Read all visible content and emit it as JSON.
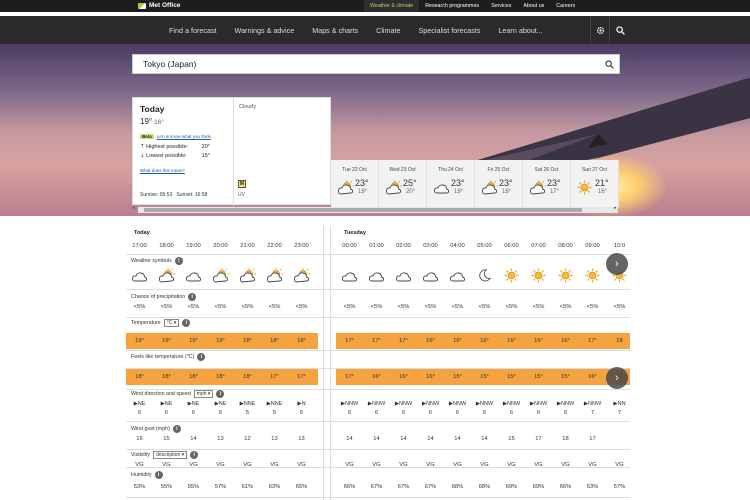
{
  "header": {
    "logo": "Met Office",
    "util_links": [
      "Weather & climate",
      "Research programmes",
      "Services",
      "About us",
      "Careers"
    ]
  },
  "nav": {
    "links": [
      "Find a forecast",
      "Warnings & advice",
      "Maps & charts",
      "Climate",
      "Specialist forecasts",
      "Learn about..."
    ]
  },
  "search": {
    "value": "Tokyo (Japan)"
  },
  "today_card": {
    "title": "Today",
    "high": "19°",
    "low": "16°",
    "beta": "Beta",
    "beta_link": "Let us know what you think",
    "highest_label": "Highest possible:",
    "highest": "20°",
    "lowest_label": "Lowest possible:",
    "lowest": "15°",
    "meaning_link": "What does this mean?",
    "sunrise_label": "Sunrise:",
    "sunrise": "05:53",
    "sunset_label": "Sunset:",
    "sunset": "16:58",
    "condition": "Cloudy",
    "uv_value": "M",
    "uv_label": "UV"
  },
  "days": [
    {
      "label": "Tue 22 Oct",
      "high": "23°",
      "low": "19°",
      "icon": "sunny-interval-icon"
    },
    {
      "label": "Wed 23 Oct",
      "high": "25°",
      "low": "20°",
      "icon": "sunny-interval-icon"
    },
    {
      "label": "Thu 24 Oct",
      "high": "23°",
      "low": "19°",
      "icon": "cloud-icon"
    },
    {
      "label": "Fri 25 Oct",
      "high": "23°",
      "low": "18°",
      "icon": "sunny-interval-icon"
    },
    {
      "label": "Sat 26 Oct",
      "high": "23°",
      "low": "17°",
      "icon": "sunny-interval-icon"
    },
    {
      "label": "Sun 27 Oct",
      "high": "21°",
      "low": "16°",
      "icon": "sunny-icon"
    }
  ],
  "table": {
    "today_label": "Today",
    "tuesday_label": "Tuesday",
    "hours_today": [
      "17:00",
      "18:00",
      "19:00",
      "20:00",
      "21:00",
      "22:00",
      "23:00"
    ],
    "hours_tue": [
      "00:00",
      "01:00",
      "02:00",
      "03:00",
      "04:00",
      "05:00",
      "06:00",
      "07:00",
      "08:00",
      "09:00",
      "10:0"
    ],
    "weather_label": "Weather symbols",
    "symbols_today": [
      "cloud",
      "sun-cloud",
      "cloud",
      "sun-cloud",
      "sun-cloud",
      "sun-cloud",
      "sun-cloud"
    ],
    "symbols_tue": [
      "cloud",
      "cloud",
      "cloud",
      "cloud",
      "cloud",
      "moon",
      "sun",
      "sun",
      "sun",
      "sun",
      "sun"
    ],
    "precip_label": "Chance of precipitation",
    "precip_today": [
      "<5%",
      "<5%",
      "<5%",
      "<5%",
      "<5%",
      "<5%",
      "<5%"
    ],
    "precip_tue": [
      "<5%",
      "<5%",
      "<5%",
      "<5%",
      "<5%",
      "<5%",
      "<5%",
      "<5%",
      "<5%",
      "<5%",
      "<5%"
    ],
    "temp_label": "Temperature",
    "temp_unit": "°C",
    "temp_today": [
      "19°",
      "19°",
      "19°",
      "19°",
      "18°",
      "18°",
      "18°"
    ],
    "temp_tue": [
      "17°",
      "17°",
      "17°",
      "16°",
      "16°",
      "16°",
      "16°",
      "16°",
      "16°",
      "17°",
      "18"
    ],
    "feels_label": "Feels like temperature (°C)",
    "feels_today": [
      "18°",
      "18°",
      "18°",
      "18°",
      "18°",
      "17°",
      "17°"
    ],
    "feels_tue": [
      "17°",
      "16°",
      "16°",
      "16°",
      "15°",
      "15°",
      "15°",
      "15°",
      "15°",
      "16°",
      "16"
    ],
    "wind_label": "Wind direction and speed",
    "wind_unit": "mph",
    "wind_dir_today": [
      "NE",
      "NE",
      "NE",
      "NE",
      "NNE",
      "NNE",
      "N"
    ],
    "wind_today": [
      "6",
      "6",
      "6",
      "6",
      "5",
      "5",
      "5"
    ],
    "wind_dir_tue": [
      "NNW",
      "NNW",
      "NNW",
      "NNW",
      "NNW",
      "NNW",
      "NNW",
      "NNW",
      "NNW",
      "NNW",
      "NN"
    ],
    "wind_tue": [
      "6",
      "6",
      "6",
      "6",
      "6",
      "6",
      "6",
      "6",
      "6",
      "7",
      "7"
    ],
    "gust_label": "Wind gust (mph)",
    "gust_today": [
      "16",
      "15",
      "14",
      "13",
      "12",
      "13",
      "13"
    ],
    "gust_tue": [
      "14",
      "14",
      "14",
      "14",
      "14",
      "14",
      "15",
      "17",
      "18",
      "17"
    ],
    "vis_label": "Visibility",
    "vis_option": "description",
    "vis_today": [
      "VG",
      "VG",
      "VG",
      "VG",
      "VG",
      "VG",
      "VG"
    ],
    "vis_tue": [
      "VG",
      "VG",
      "VG",
      "VG",
      "VG",
      "VG",
      "VG",
      "VG",
      "VG",
      "VG",
      "VG"
    ],
    "hum_label": "Humidity",
    "hum_today": [
      "53%",
      "55%",
      "55%",
      "57%",
      "61%",
      "63%",
      "65%"
    ],
    "hum_tue": [
      "66%",
      "67%",
      "67%",
      "67%",
      "68%",
      "68%",
      "69%",
      "69%",
      "66%",
      "63%",
      "57%"
    ]
  }
}
